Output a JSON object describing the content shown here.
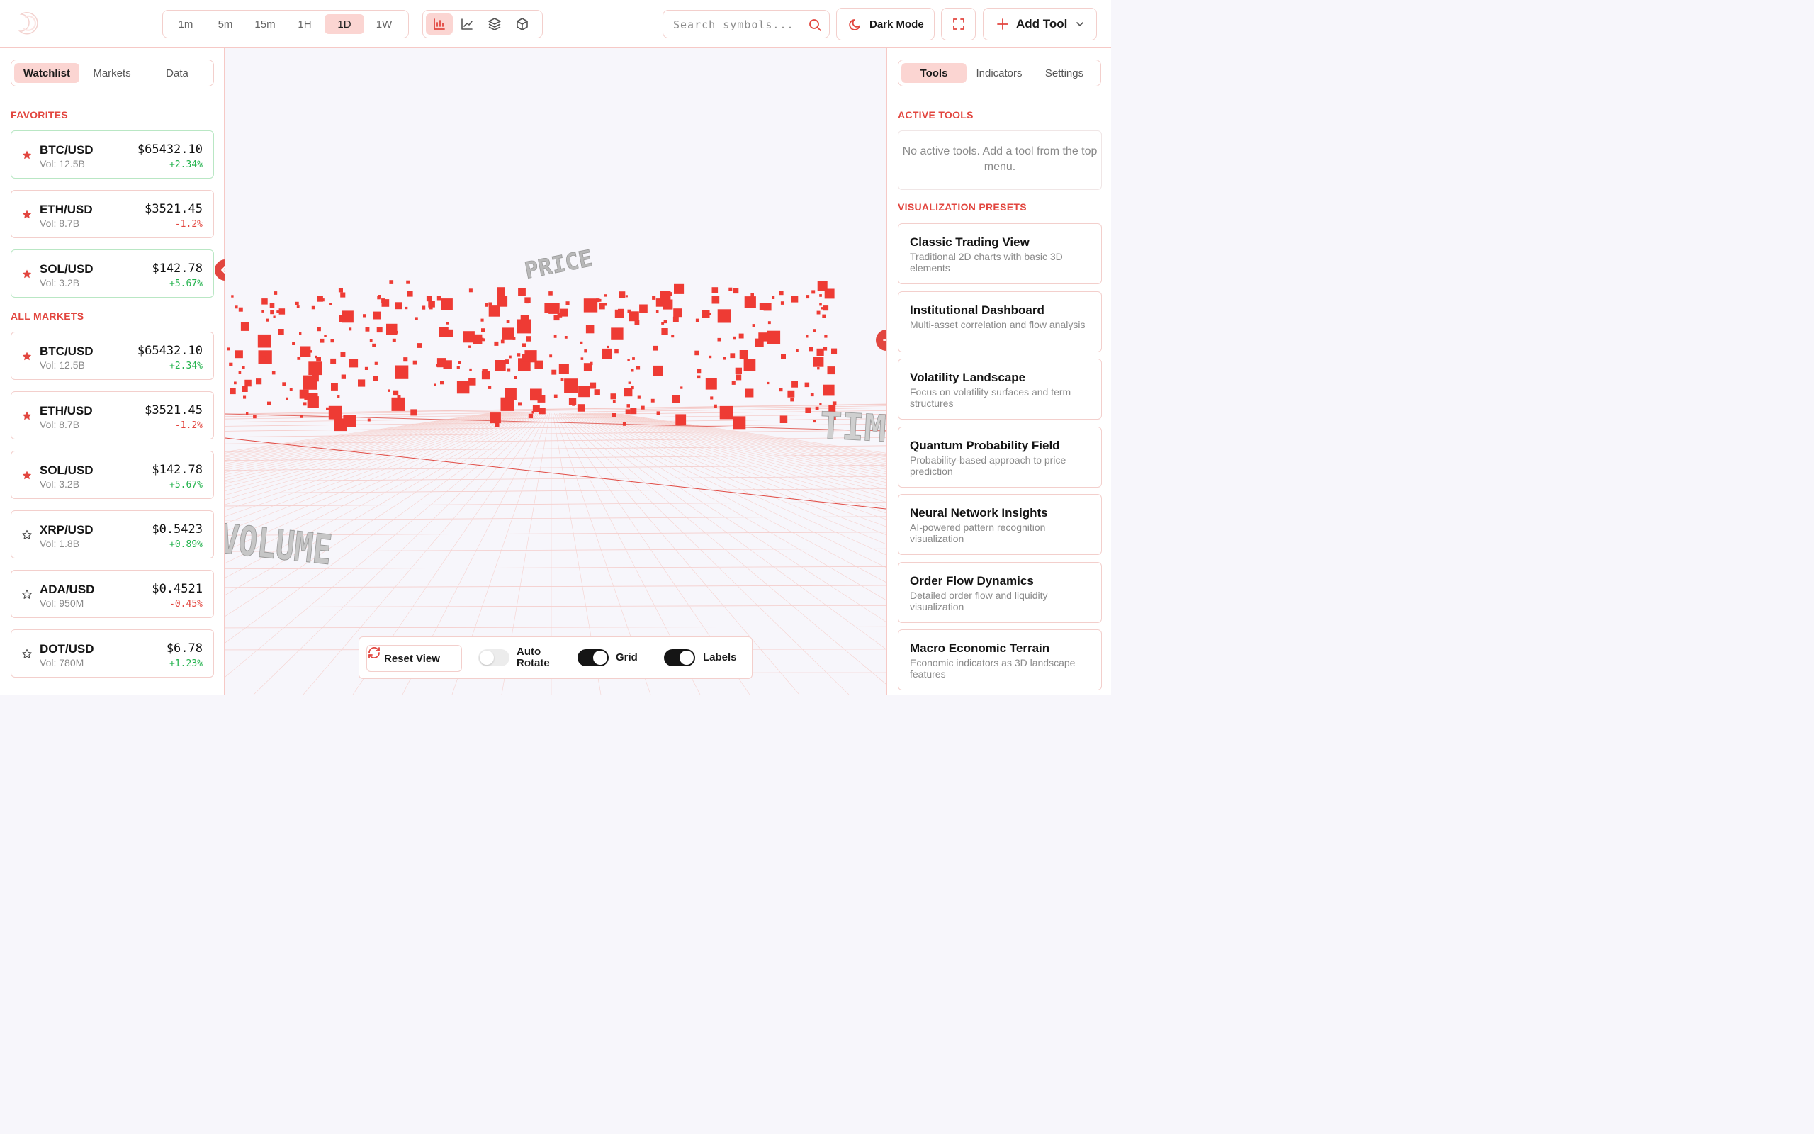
{
  "header": {
    "timeframes": [
      "1m",
      "5m",
      "15m",
      "1H",
      "1D",
      "1W"
    ],
    "active_timeframe": "1D",
    "view_modes": [
      "bar-chart-icon",
      "line-chart-icon",
      "layers-icon",
      "cube-icon"
    ],
    "search_placeholder": "Search symbols...",
    "dark_mode_label": "Dark Mode",
    "add_tool_label": "Add Tool"
  },
  "left_panel": {
    "tabs": [
      "Watchlist",
      "Markets",
      "Data"
    ],
    "favorites_title": "FAVORITES",
    "favorites": [
      {
        "symbol": "BTC/USD",
        "volume": "Vol: 12.5B",
        "price": "$65432.10",
        "change": "+2.34%",
        "direction": "up",
        "starred": true
      },
      {
        "symbol": "ETH/USD",
        "volume": "Vol: 8.7B",
        "price": "$3521.45",
        "change": "-1.2%",
        "direction": "down",
        "starred": true
      },
      {
        "symbol": "SOL/USD",
        "volume": "Vol: 3.2B",
        "price": "$142.78",
        "change": "+5.67%",
        "direction": "up",
        "starred": true
      }
    ],
    "all_markets_title": "ALL MARKETS",
    "markets": [
      {
        "symbol": "BTC/USD",
        "volume": "Vol: 12.5B",
        "price": "$65432.10",
        "change": "+2.34%",
        "direction": "up",
        "starred": true
      },
      {
        "symbol": "ETH/USD",
        "volume": "Vol: 8.7B",
        "price": "$3521.45",
        "change": "-1.2%",
        "direction": "down",
        "starred": true
      },
      {
        "symbol": "SOL/USD",
        "volume": "Vol: 3.2B",
        "price": "$142.78",
        "change": "+5.67%",
        "direction": "up",
        "starred": true
      },
      {
        "symbol": "XRP/USD",
        "volume": "Vol: 1.8B",
        "price": "$0.5423",
        "change": "+0.89%",
        "direction": "up",
        "starred": false
      },
      {
        "symbol": "ADA/USD",
        "volume": "Vol: 950M",
        "price": "$0.4521",
        "change": "-0.45%",
        "direction": "down",
        "starred": false
      },
      {
        "symbol": "DOT/USD",
        "volume": "Vol: 780M",
        "price": "$6.78",
        "change": "+1.23%",
        "direction": "up",
        "starred": false
      }
    ]
  },
  "scene": {
    "axis_labels": {
      "price": "PRICE",
      "volume": "VOLUME",
      "time": "TIM"
    },
    "controls": {
      "reset_label": "Reset View",
      "auto_rotate_label": "Auto Rotate",
      "auto_rotate_on": false,
      "grid_label": "Grid",
      "grid_on": true,
      "labels_label": "Labels",
      "labels_on": true
    }
  },
  "right_panel": {
    "tabs": [
      "Tools",
      "Indicators",
      "Settings"
    ],
    "active_tools_title": "ACTIVE TOOLS",
    "no_tools_text": "No active tools. Add a tool from the top menu.",
    "presets_title": "VISUALIZATION PRESETS",
    "presets": [
      {
        "title": "Classic Trading View",
        "desc": "Traditional 2D charts with basic 3D elements"
      },
      {
        "title": "Institutional Dashboard",
        "desc": "Multi-asset correlation and flow analysis"
      },
      {
        "title": "Volatility Landscape",
        "desc": "Focus on volatility surfaces and term structures"
      },
      {
        "title": "Quantum Probability Field",
        "desc": "Probability-based approach to price prediction"
      },
      {
        "title": "Neural Network Insights",
        "desc": "AI-powered pattern recognition visualization"
      },
      {
        "title": "Order Flow Dynamics",
        "desc": "Detailed order flow and liquidity visualization"
      },
      {
        "title": "Macro Economic Terrain",
        "desc": "Economic indicators as 3D landscape features"
      }
    ]
  },
  "colors": {
    "accent": "#e2463f",
    "accent_soft": "#fbd5d2",
    "border": "#f3cfcc",
    "up": "#22b24c",
    "down": "#e2463f"
  }
}
